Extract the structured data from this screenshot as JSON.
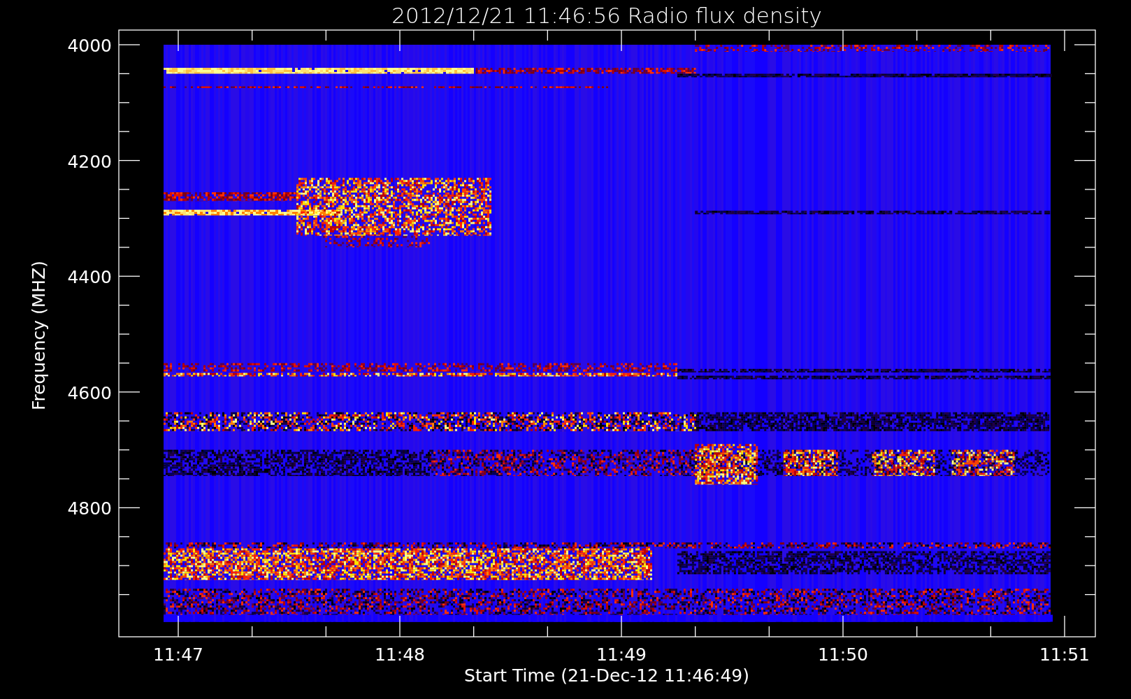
{
  "title": "2012/12/21 11:46:56 Radio flux density",
  "y_axis": {
    "label": "Frequency (MHZ)",
    "ticks": [
      "4000",
      "4200",
      "4400",
      "4600",
      "4800"
    ]
  },
  "x_axis": {
    "label": "Start Time (21-Dec-12 11:46:49)",
    "ticks": [
      "11:47",
      "11:48",
      "11:49",
      "11:50",
      "11:51"
    ]
  }
}
